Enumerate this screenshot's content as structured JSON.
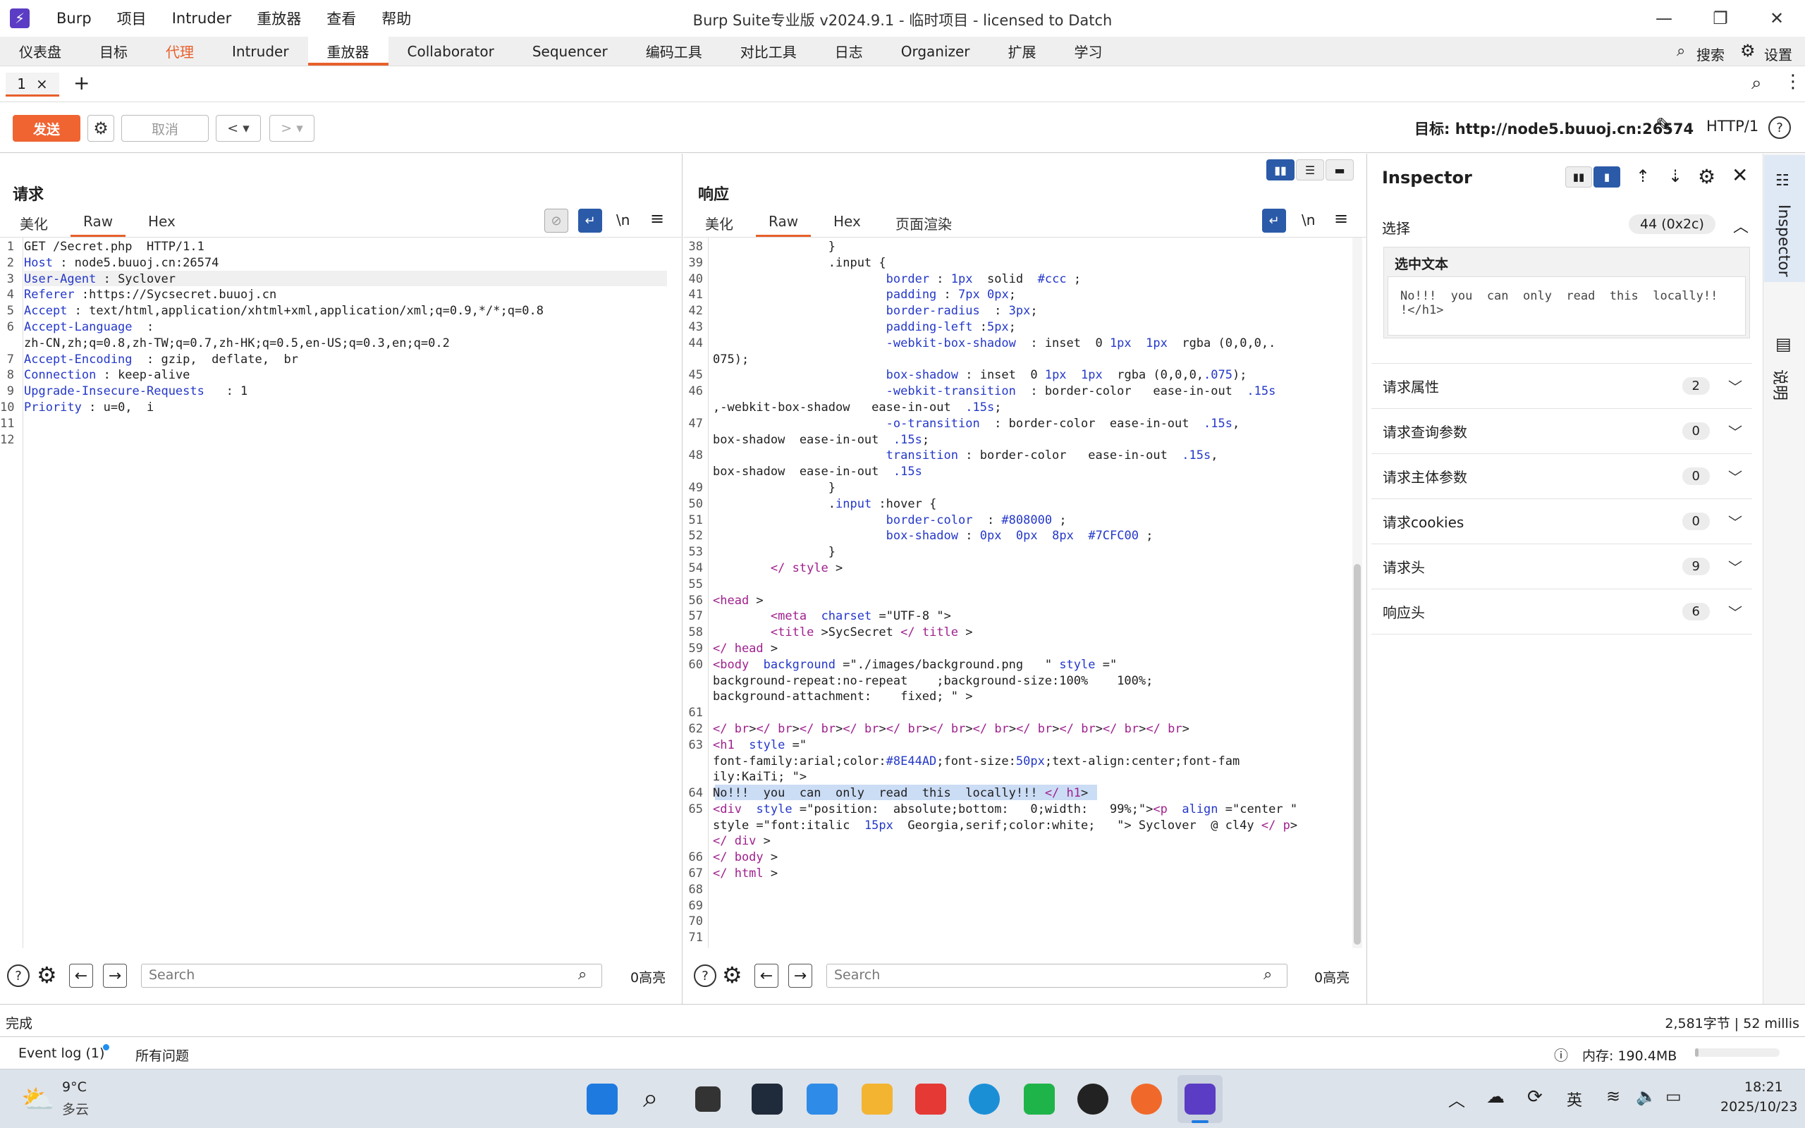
{
  "app": {
    "menus": [
      "Burp",
      "项目",
      "Intruder",
      "重放器",
      "查看",
      "帮助"
    ],
    "title": "Burp Suite专业版  v2024.9.1 - 临时项目 - licensed to Datch"
  },
  "main_tabs": [
    "仪表盘",
    "目标",
    "代理",
    "Intruder",
    "重放器",
    "Collaborator",
    "Sequencer",
    "编码工具",
    "对比工具",
    "日志",
    "Organizer",
    "扩展",
    "学习"
  ],
  "main_tab_active": "重放器",
  "top_right": {
    "search_label": "搜索",
    "settings_label": "设置"
  },
  "repeater_tab": {
    "label": "1",
    "close": "×",
    "add": "+"
  },
  "toolbar": {
    "send_label": "发送",
    "cancel_label": "取消",
    "target": "目标: http://node5.buuoj.cn:26574",
    "protocol": "HTTP/1"
  },
  "request": {
    "title": "请求",
    "tabs": [
      "美化",
      "Raw",
      "Hex"
    ],
    "active_tab": "Raw",
    "lines": [
      {
        "n": "1",
        "t": "GET /Secret.php  HTTP/1.1"
      },
      {
        "n": "2",
        "t": "Host : node5.buuoj.cn:26574"
      },
      {
        "n": "3",
        "t": "User-Agent : Syclover"
      },
      {
        "n": "4",
        "t": "Referer :https://Sycsecret.buuoj.cn"
      },
      {
        "n": "5",
        "t": "Accept : text/html,application/xhtml+xml,application/xml;q=0.9,*/*;q=0.8"
      },
      {
        "n": "6",
        "t": "Accept-Language  :"
      },
      {
        "n": "",
        "t": "zh-CN,zh;q=0.8,zh-TW;q=0.7,zh-HK;q=0.5,en-US;q=0.3,en;q=0.2"
      },
      {
        "n": "7",
        "t": "Accept-Encoding  : gzip,  deflate,  br"
      },
      {
        "n": "8",
        "t": "Connection : keep-alive"
      },
      {
        "n": "9",
        "t": "Upgrade-Insecure-Requests   : 1"
      },
      {
        "n": "10",
        "t": "Priority : u=0,  i"
      },
      {
        "n": "11",
        "t": ""
      },
      {
        "n": "12",
        "t": ""
      }
    ],
    "search_placeholder": "Search",
    "highlights": "0高亮"
  },
  "response": {
    "title": "响应",
    "tabs": [
      "美化",
      "Raw",
      "Hex",
      "页面渲染"
    ],
    "active_tab": "Raw",
    "lines": [
      {
        "n": "38",
        "t": "                }"
      },
      {
        "n": "39",
        "t": "                .input {"
      },
      {
        "n": "40",
        "t": "                        border : 1px  solid  #ccc ;"
      },
      {
        "n": "41",
        "t": "                        padding : 7px 0px;"
      },
      {
        "n": "42",
        "t": "                        border-radius  : 3px;"
      },
      {
        "n": "43",
        "t": "                        padding-left :5px;"
      },
      {
        "n": "44",
        "t": "                        -webkit-box-shadow  : inset  0 1px  1px  rgba (0,0,0,."
      },
      {
        "n": "",
        "t": "075);"
      },
      {
        "n": "45",
        "t": "                        box-shadow : inset  0 1px  1px  rgba (0,0,0,.075);"
      },
      {
        "n": "46",
        "t": "                        -webkit-transition  : border-color   ease-in-out  .15s"
      },
      {
        "n": "",
        "t": ",-webkit-box-shadow   ease-in-out  .15s;"
      },
      {
        "n": "47",
        "t": "                        -o-transition  : border-color  ease-in-out  .15s,"
      },
      {
        "n": "",
        "t": "box-shadow  ease-in-out  .15s;"
      },
      {
        "n": "48",
        "t": "                        transition : border-color   ease-in-out  .15s,"
      },
      {
        "n": "",
        "t": "box-shadow  ease-in-out  .15s"
      },
      {
        "n": "49",
        "t": "                }"
      },
      {
        "n": "50",
        "t": "                .input :hover {"
      },
      {
        "n": "51",
        "t": "                        border-color  : #808000 ;"
      },
      {
        "n": "52",
        "t": "                        box-shadow : 0px  0px  8px  #7CFC00 ;"
      },
      {
        "n": "53",
        "t": "                }"
      },
      {
        "n": "54",
        "t": "        </ style >"
      },
      {
        "n": "55",
        "t": ""
      },
      {
        "n": "56",
        "t": "<head >"
      },
      {
        "n": "57",
        "t": "        <meta  charset =\"UTF-8 \">"
      },
      {
        "n": "58",
        "t": "        <title >SycSecret </ title >"
      },
      {
        "n": "59",
        "t": "</ head >"
      },
      {
        "n": "60",
        "t": "<body  background =\"./images/background.png   \" style =\""
      },
      {
        "n": "",
        "t": "background-repeat:no-repeat    ;background-size:100%    100%;"
      },
      {
        "n": "",
        "t": "background-attachment:    fixed; \" >"
      },
      {
        "n": "61",
        "t": ""
      },
      {
        "n": "62",
        "t": "</ br></ br></ br></ br></ br></ br></ br></ br></ br></ br></ br>"
      },
      {
        "n": "63",
        "t": "<h1  style =\""
      },
      {
        "n": "",
        "t": "font-family:arial;color:#8E44AD;font-size:50px;text-align:center;font-fam"
      },
      {
        "n": "",
        "t": "ily:KaiTi; \">"
      },
      {
        "n": "64",
        "t": "No!!!  you  can  only  read  this  locally!!! </ h1>"
      },
      {
        "n": "65",
        "t": "<div  style =\"position:  absolute;bottom:   0;width:   99%;\"><p  align =\"center \""
      },
      {
        "n": "",
        "t": "style =\"font:italic  15px  Georgia,serif;color:white;   \"> Syclover  @ cl4y </ p>"
      },
      {
        "n": "",
        "t": "</ div >"
      },
      {
        "n": "66",
        "t": "</ body >"
      },
      {
        "n": "67",
        "t": "</ html >"
      },
      {
        "n": "68",
        "t": ""
      },
      {
        "n": "69",
        "t": ""
      },
      {
        "n": "70",
        "t": ""
      },
      {
        "n": "71",
        "t": ""
      }
    ],
    "search_placeholder": "Search",
    "highlights": "0高亮"
  },
  "inspector": {
    "title": "Inspector",
    "selection_label": "选择",
    "selection_value": "44 (0x2c)",
    "selected_text_label": "选中文本",
    "selected_text": "No!!!  you  can  only  read  this  locally!!\n!</h1>",
    "sections": [
      {
        "label": "请求属性",
        "count": "2"
      },
      {
        "label": "请求查询参数",
        "count": "0"
      },
      {
        "label": "请求主体参数",
        "count": "0"
      },
      {
        "label": "请求cookies",
        "count": "0"
      },
      {
        "label": "请求头",
        "count": "9"
      },
      {
        "label": "响应头",
        "count": "6"
      }
    ],
    "side_tabs": [
      "Inspector",
      "说明"
    ]
  },
  "status": {
    "left": "完成",
    "right": "2,581字节 | 52 millis",
    "event_log": "Event log (1)",
    "all_issues": "所有问题",
    "memory": "内存: 190.4MB"
  },
  "taskbar": {
    "weather_temp": "9°C",
    "weather_desc": "多云",
    "ime": "英",
    "time": "18:21",
    "date": "2025/10/23"
  }
}
